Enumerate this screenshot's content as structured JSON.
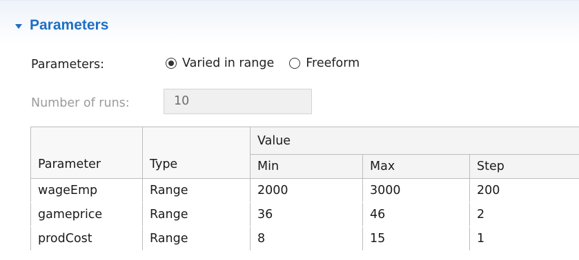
{
  "section": {
    "title": "Parameters"
  },
  "parameters_row": {
    "label": "Parameters:",
    "options": [
      {
        "label": "Varied in range",
        "selected": true
      },
      {
        "label": "Freeform",
        "selected": false
      }
    ]
  },
  "runs": {
    "label": "Number of runs:",
    "value": "10"
  },
  "table": {
    "headers": {
      "parameter": "Parameter",
      "type": "Type",
      "value_group": "Value",
      "min": "Min",
      "max": "Max",
      "step": "Step"
    },
    "rows": [
      {
        "parameter": "wageEmp",
        "type": "Range",
        "min": "2000",
        "max": "3000",
        "step": "200"
      },
      {
        "parameter": "gameprice",
        "type": "Range",
        "min": "36",
        "max": "46",
        "step": "2"
      },
      {
        "parameter": "prodCost",
        "type": "Range",
        "min": "8",
        "max": "15",
        "step": "1"
      }
    ]
  },
  "colors": {
    "accent": "#1e6fc4",
    "disabled_text": "#9b9b9b",
    "grid": "#bcbcbc"
  }
}
